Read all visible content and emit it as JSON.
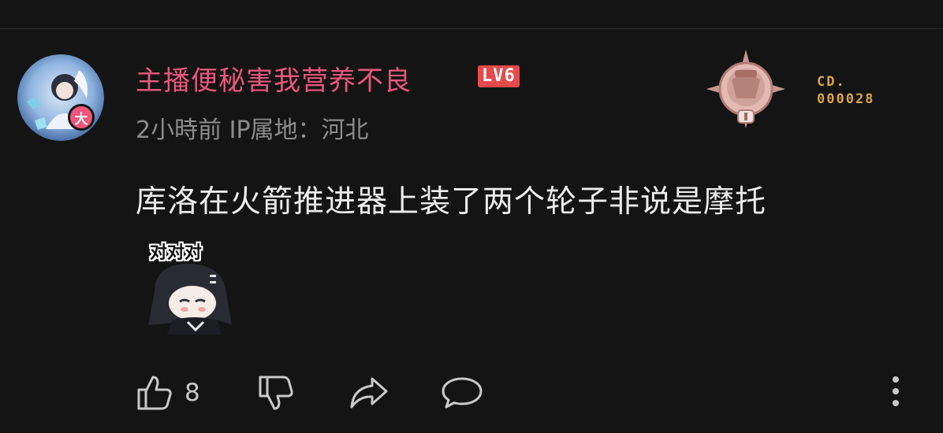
{
  "comment": {
    "username": "主播便秘害我营养不良",
    "level_badge": "LV6",
    "avatar_badge": "大",
    "meta": "2小時前 IP属地：河北",
    "medal_label": "CD.",
    "medal_number": "000028",
    "text": "库洛在火箭推进器上装了两个轮子非说是摩托",
    "sticker_caption": "对对对",
    "like_count": "8"
  },
  "colors": {
    "background": "#141414",
    "username": "#e8577e",
    "level_badge": "#e64a4a",
    "meta": "#8d8d8d",
    "medal_text": "#d9a44a"
  },
  "icons": [
    "like-icon",
    "dislike-icon",
    "share-icon",
    "reply-icon",
    "more-icon"
  ]
}
